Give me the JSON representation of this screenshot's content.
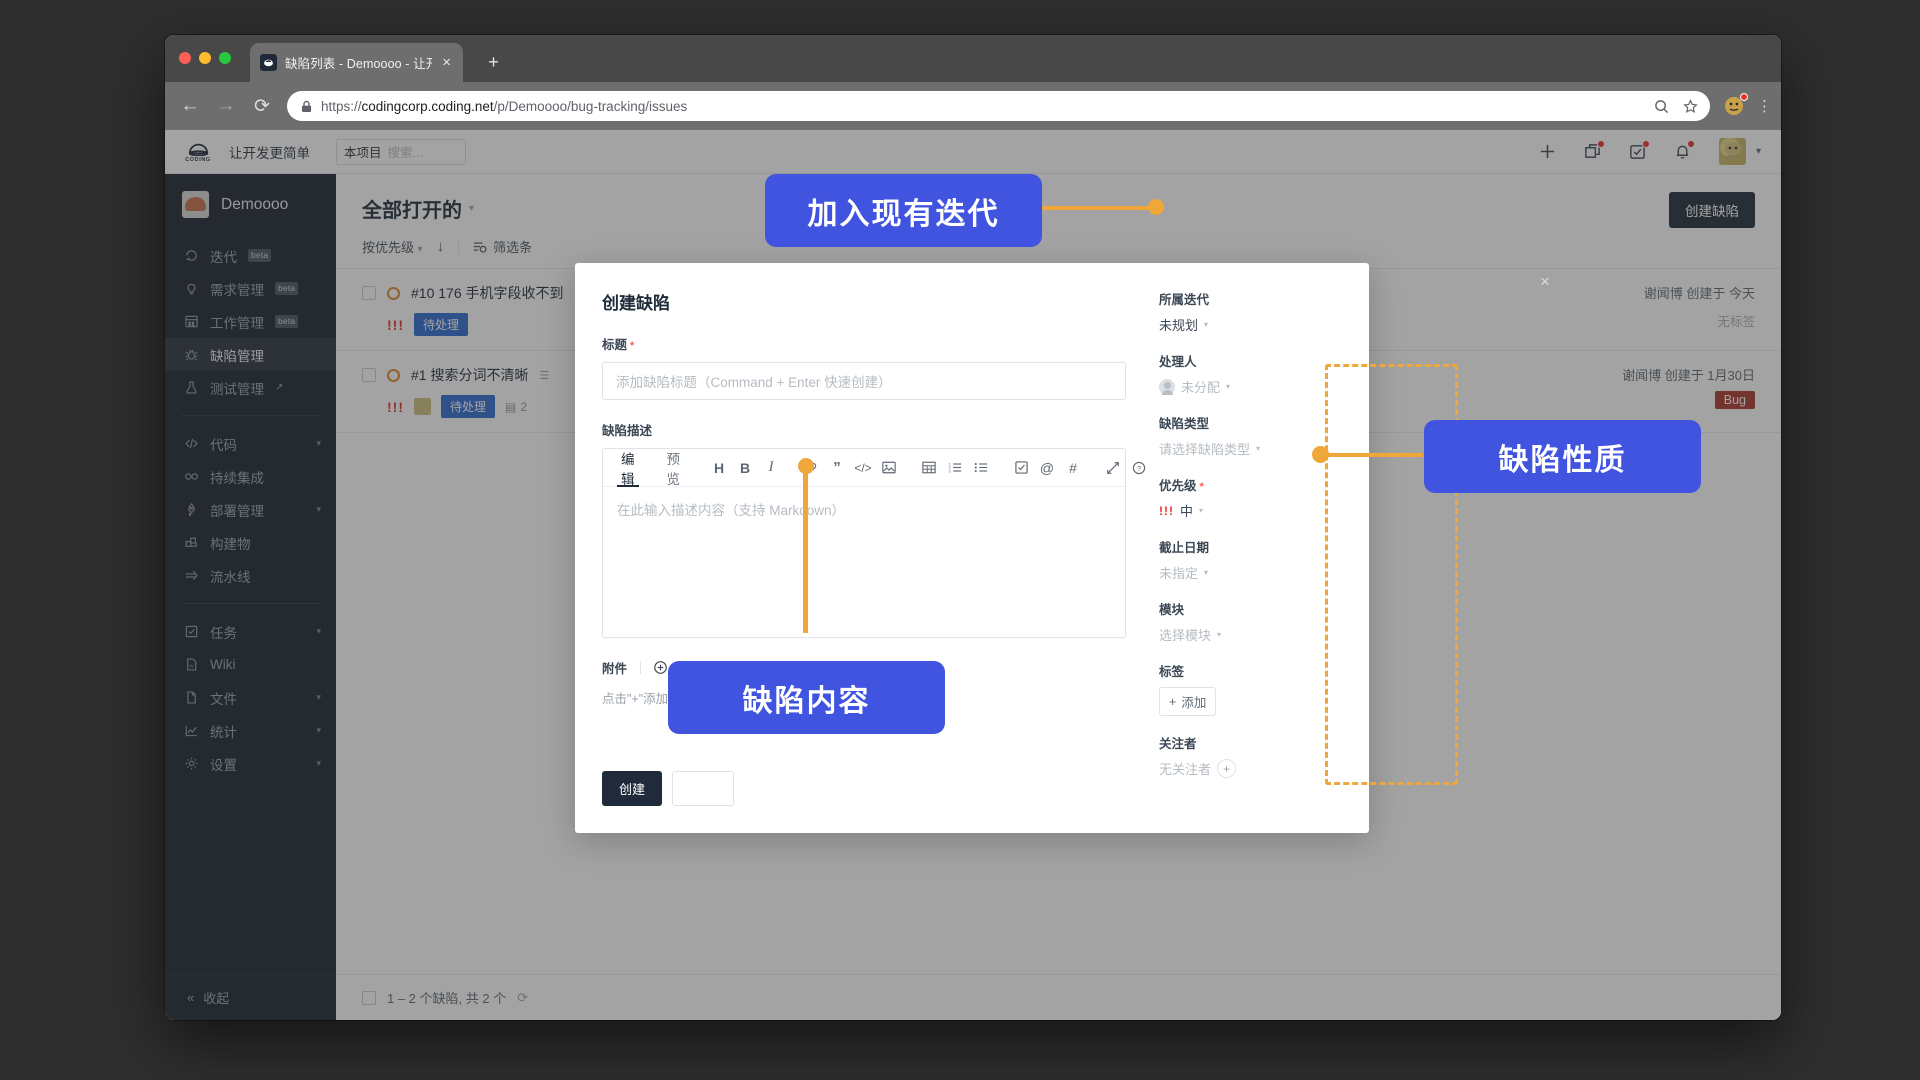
{
  "browser": {
    "tab_title": "缺陷列表 - Demoooo - 让开发更",
    "url_scheme": "https://",
    "url_domain": "codingcorp.coding.net",
    "url_path": "/p/Demoooo/bug-tracking/issues",
    "new_tab_label": "+",
    "close_tab_label": "×"
  },
  "topbar": {
    "brand_word": "CODING",
    "slogan": "让开发更简单",
    "search_scope": "本项目",
    "search_placeholder": "搜索...",
    "icons": [
      "plus-icon",
      "copy-icon",
      "task-icon",
      "bell-icon",
      "avatar",
      "chevron-down-icon"
    ]
  },
  "sidebar": {
    "project_name": "Demoooo",
    "groups": [
      {
        "items": [
          {
            "label": "迭代",
            "badge": "beta",
            "icon": "sprint-icon",
            "active": false,
            "chevron": false,
            "external": false
          },
          {
            "label": "需求管理",
            "badge": "beta",
            "icon": "bulb-icon",
            "active": false,
            "chevron": false,
            "external": false
          },
          {
            "label": "工作管理",
            "badge": "beta",
            "icon": "grid-icon",
            "active": false,
            "chevron": false,
            "external": false
          },
          {
            "label": "缺陷管理",
            "badge": "",
            "icon": "bug-icon",
            "active": true,
            "chevron": false,
            "external": false
          },
          {
            "label": "测试管理",
            "badge": "",
            "icon": "flask-icon",
            "active": false,
            "chevron": false,
            "external": true
          }
        ]
      },
      {
        "items": [
          {
            "label": "代码",
            "badge": "",
            "icon": "code-icon",
            "active": false,
            "chevron": true,
            "external": false
          },
          {
            "label": "持续集成",
            "badge": "",
            "icon": "infinity-icon",
            "active": false,
            "chevron": false,
            "external": false
          },
          {
            "label": "部署管理",
            "badge": "",
            "icon": "rocket-icon",
            "active": false,
            "chevron": true,
            "external": false
          },
          {
            "label": "构建物",
            "badge": "",
            "icon": "package-icon",
            "active": false,
            "chevron": false,
            "external": false
          },
          {
            "label": "流水线",
            "badge": "",
            "icon": "arrow-right-icon",
            "active": false,
            "chevron": false,
            "external": false
          }
        ]
      },
      {
        "items": [
          {
            "label": "任务",
            "badge": "",
            "icon": "checkbox-icon",
            "active": false,
            "chevron": true,
            "external": false
          },
          {
            "label": "Wiki",
            "badge": "",
            "icon": "wiki-icon",
            "active": false,
            "chevron": false,
            "external": false
          },
          {
            "label": "文件",
            "badge": "",
            "icon": "file-icon",
            "active": false,
            "chevron": true,
            "external": false
          },
          {
            "label": "统计",
            "badge": "",
            "icon": "chart-icon",
            "active": false,
            "chevron": true,
            "external": false
          },
          {
            "label": "设置",
            "badge": "",
            "icon": "gear-icon",
            "active": false,
            "chevron": true,
            "external": false
          }
        ]
      }
    ],
    "collapse_label": "收起"
  },
  "main": {
    "page_title": "全部打开的",
    "sort_label": "按优先级",
    "filter_label": "筛选条",
    "create_button": "创建缺陷",
    "rows": [
      {
        "id": "#10 176",
        "title": "手机字段收不到",
        "priority": "!!!",
        "status": "待处理",
        "author": "谢闻博 创建于 今天",
        "tags": "无标签",
        "has_avatar": false,
        "date": "",
        "bug_chip": ""
      },
      {
        "id": "#1",
        "title": "搜索分词不清晰",
        "priority": "!!!",
        "status": "待处理",
        "author": "谢闻博 创建于 1月30日",
        "tags": "",
        "has_avatar": true,
        "date": "2",
        "bug_chip": "Bug"
      }
    ],
    "footer_count": "1 – 2 个缺陷, 共 2 个"
  },
  "modal": {
    "title": "创建缺陷",
    "close_label": "×",
    "title_field_label": "标题",
    "title_field_placeholder": "添加缺陷标题（Command + Enter 快速创建）",
    "desc_label": "缺陷描述",
    "editor_tabs": [
      "编辑",
      "预览"
    ],
    "editor_active_tab": "编辑",
    "editor_placeholder": "在此输入描述内容（支持 Markdown）",
    "toolbar_icons": [
      "heading-icon",
      "bold-icon",
      "italic-icon",
      "link-icon",
      "quote-icon",
      "code-icon",
      "image-icon",
      "table-icon",
      "ordered-list-icon",
      "bullet-list-icon",
      "task-list-icon",
      "mention-icon",
      "hash-icon",
      "fullscreen-icon",
      "help-icon"
    ],
    "attachment_label": "附件",
    "attachment_add": "添加附件",
    "attachment_hint": "点击\"+\"添加附件",
    "submit_label": "创建",
    "cancel_label": "",
    "fields": [
      {
        "label": "所属迭代",
        "value": "未规划",
        "muted": false,
        "required": false,
        "kind": "select"
      },
      {
        "label": "处理人",
        "value": "未分配",
        "muted": true,
        "required": false,
        "kind": "assignee"
      },
      {
        "label": "缺陷类型",
        "value": "请选择缺陷类型",
        "muted": true,
        "required": false,
        "kind": "select"
      },
      {
        "label": "优先级",
        "value": "中",
        "muted": false,
        "required": true,
        "kind": "priority"
      },
      {
        "label": "截止日期",
        "value": "未指定",
        "muted": true,
        "required": false,
        "kind": "select"
      },
      {
        "label": "模块",
        "value": "选择模块",
        "muted": true,
        "required": false,
        "kind": "select"
      },
      {
        "label": "标签",
        "value": "添加",
        "muted": false,
        "required": false,
        "kind": "tag"
      },
      {
        "label": "关注者",
        "value": "无关注者",
        "muted": true,
        "required": false,
        "kind": "watcher"
      }
    ]
  },
  "callouts": [
    {
      "id": "iteration",
      "text": "加入现有迭代"
    },
    {
      "id": "nature",
      "text": "缺陷性质"
    },
    {
      "id": "content",
      "text": "缺陷内容"
    }
  ],
  "colors": {
    "accent_blue": "#4154e0",
    "highlight_orange": "#f0a73a",
    "sidebar_bg": "#1b2430",
    "danger_red": "#e8322a",
    "status_blue": "#2d6bcf",
    "bug_red": "#a8332b"
  }
}
